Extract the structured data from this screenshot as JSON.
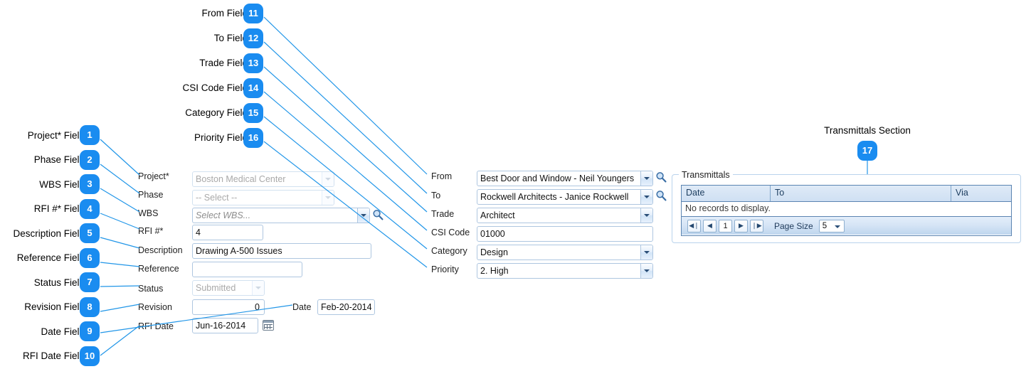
{
  "colors": {
    "badge": "#1a8cf0",
    "leader_line": "#2196e8",
    "field_border": "#aec6e0",
    "grid_border": "#5b84b1",
    "grid_header_text": "#1b3c5e"
  },
  "callouts": [
    {
      "n": "1",
      "label": "Project* Field"
    },
    {
      "n": "2",
      "label": "Phase Field"
    },
    {
      "n": "3",
      "label": "WBS Field"
    },
    {
      "n": "4",
      "label": "RFI #* Field"
    },
    {
      "n": "5",
      "label": "Description Field"
    },
    {
      "n": "6",
      "label": "Reference Field"
    },
    {
      "n": "7",
      "label": "Status Field"
    },
    {
      "n": "8",
      "label": "Revision Field"
    },
    {
      "n": "9",
      "label": "Date Field"
    },
    {
      "n": "10",
      "label": "RFI Date Field"
    },
    {
      "n": "11",
      "label": "From Field"
    },
    {
      "n": "12",
      "label": "To Field"
    },
    {
      "n": "13",
      "label": "Trade Field"
    },
    {
      "n": "14",
      "label": "CSI Code Field"
    },
    {
      "n": "15",
      "label": "Category Field"
    },
    {
      "n": "16",
      "label": "Priority Field"
    },
    {
      "n": "17",
      "label": "Transmittals Section"
    }
  ],
  "form": {
    "left_column": {
      "project": {
        "label": "Project*",
        "value": "Boston Medical Center",
        "state": "disabled",
        "control": "combo"
      },
      "phase": {
        "label": "Phase",
        "value": "-- Select --",
        "state": "disabled",
        "control": "combo"
      },
      "wbs": {
        "label": "WBS",
        "value": "Select WBS...",
        "state": "placeholder",
        "control": "combo-search"
      },
      "rfi_number": {
        "label": "RFI #*",
        "value": "4",
        "control": "text"
      },
      "description": {
        "label": "Description",
        "value": "Drawing A-500 Issues",
        "control": "text"
      },
      "reference": {
        "label": "Reference",
        "value": "",
        "control": "text"
      },
      "status": {
        "label": "Status",
        "value": "Submitted",
        "state": "disabled",
        "control": "combo"
      },
      "revision": {
        "label": "Revision",
        "value": "0",
        "control": "number"
      },
      "date": {
        "label": "Date",
        "value": "Feb-20-2014",
        "control": "text"
      },
      "rfi_date": {
        "label": "RFI Date",
        "value": "Jun-16-2014",
        "control": "date"
      }
    },
    "right_column": {
      "from": {
        "label": "From",
        "value": "Best Door and Window - Neil Youngers",
        "control": "combo-search"
      },
      "to": {
        "label": "To",
        "value": "Rockwell Architects - Janice Rockwell",
        "control": "combo-search"
      },
      "trade": {
        "label": "Trade",
        "value": "Architect",
        "control": "combo"
      },
      "csi_code": {
        "label": "CSI Code",
        "value": "01000",
        "control": "text"
      },
      "category": {
        "label": "Category",
        "value": "Design",
        "control": "combo"
      },
      "priority": {
        "label": "Priority",
        "value": "2. High",
        "control": "combo"
      }
    }
  },
  "transmittals": {
    "legend": "Transmittals",
    "columns": [
      "Date",
      "To",
      "Via"
    ],
    "rows": [],
    "empty_text": "No records to display.",
    "pager": {
      "first": "◀❘",
      "prev": "◀",
      "page": "1",
      "next": "▶",
      "last": "❘▶",
      "page_size_label": "Page Size",
      "page_size_value": "5"
    }
  }
}
